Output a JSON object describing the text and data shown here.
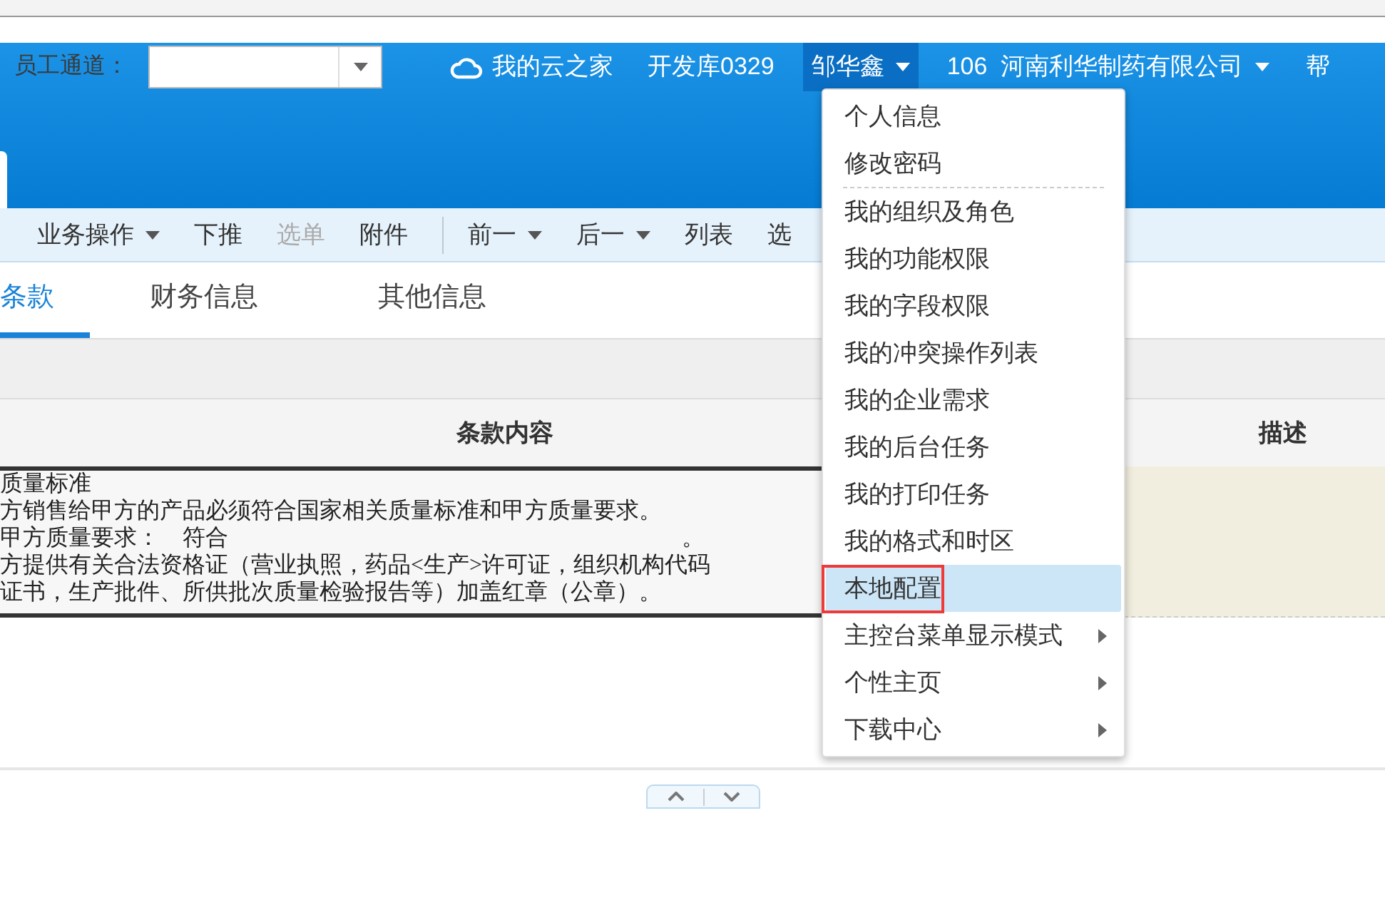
{
  "header": {
    "channel_label": "员工通道：",
    "links": [
      {
        "label": "我的云之家",
        "kind": "cloud"
      },
      {
        "label": "开发库0329",
        "kind": "plain"
      }
    ],
    "user": {
      "label": "邹华鑫",
      "expanded": true
    },
    "org": {
      "code": "106",
      "name": "河南利华制药有限公司"
    },
    "help": "帮"
  },
  "toolbar": [
    {
      "label": "业务操作",
      "kind": "dropdown",
      "disabled": false
    },
    {
      "label": "下推",
      "kind": "button",
      "disabled": false
    },
    {
      "label": "选单",
      "kind": "button",
      "disabled": true
    },
    {
      "label": "附件",
      "kind": "button",
      "disabled": false
    },
    {
      "kind": "divider"
    },
    {
      "label": "前一",
      "kind": "dropdown",
      "disabled": false
    },
    {
      "label": "后一",
      "kind": "dropdown",
      "disabled": false
    },
    {
      "label": "列表",
      "kind": "button",
      "disabled": false
    },
    {
      "label": "选",
      "kind": "button",
      "disabled": false
    }
  ],
  "tabs": [
    {
      "label": "条款",
      "selected": true
    },
    {
      "label": "财务信息",
      "selected": false
    },
    {
      "label": "其他信息",
      "selected": false
    }
  ],
  "table": {
    "columns": [
      "条款内容",
      "描述"
    ],
    "lines": [
      "质量标准",
      "方销售给甲方的产品必须符合国家相关质量标准和甲方质量要求。",
      "甲方质量要求：　符合",
      "方提供有关合法资格证（营业执照，药品<生产>许可证，组织机构代码",
      "证书，生产批件、所供批次质量检验报告等）加盖红章（公章）。"
    ],
    "line_end_mark": "。"
  },
  "user_menu": [
    {
      "label": "个人信息",
      "kind": "item",
      "selected": false,
      "annotated": false
    },
    {
      "label": "修改密码",
      "kind": "item",
      "selected": false,
      "annotated": false
    },
    {
      "kind": "separator"
    },
    {
      "label": "我的组织及角色",
      "kind": "item",
      "selected": false,
      "annotated": false
    },
    {
      "label": "我的功能权限",
      "kind": "item",
      "selected": false,
      "annotated": false
    },
    {
      "label": "我的字段权限",
      "kind": "item",
      "selected": false,
      "annotated": false
    },
    {
      "label": "我的冲突操作列表",
      "kind": "item",
      "selected": false,
      "annotated": false
    },
    {
      "label": "我的企业需求",
      "kind": "item",
      "selected": false,
      "annotated": false
    },
    {
      "label": "我的后台任务",
      "kind": "item",
      "selected": false,
      "annotated": false
    },
    {
      "label": "我的打印任务",
      "kind": "item",
      "selected": false,
      "annotated": false
    },
    {
      "label": "我的格式和时区",
      "kind": "item",
      "selected": false,
      "annotated": false
    },
    {
      "label": "本地配置",
      "kind": "item",
      "selected": true,
      "annotated": true
    },
    {
      "label": "主控台菜单显示模式",
      "kind": "submenu",
      "selected": false,
      "annotated": false
    },
    {
      "label": "个性主页",
      "kind": "submenu",
      "selected": false,
      "annotated": false
    },
    {
      "label": "下载中心",
      "kind": "submenu",
      "selected": false,
      "annotated": false
    }
  ]
}
